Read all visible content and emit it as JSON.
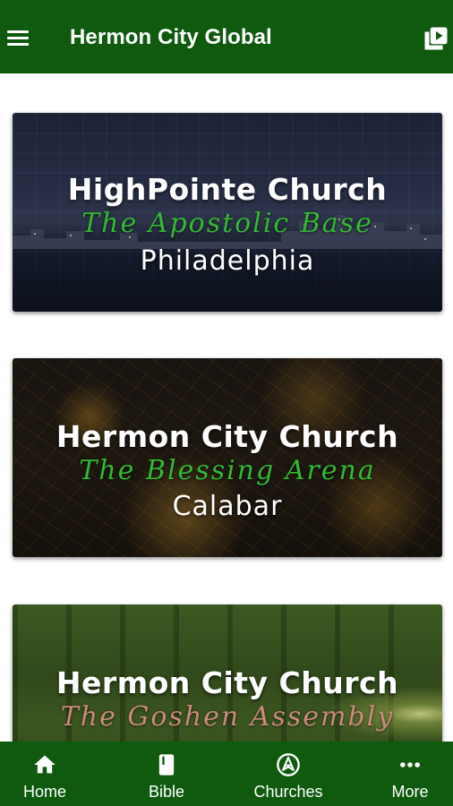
{
  "app_bar": {
    "title": "Hermon City Global",
    "menu_icon": "hamburger-menu-icon",
    "action_icon": "video-library-icon"
  },
  "colors": {
    "primary": "#0f5a0f",
    "accent_green": "#33b833",
    "accent_pink": "#c98a7a",
    "white": "#ffffff"
  },
  "cards": [
    {
      "title": "HighPointe Church",
      "subtitle": "The Apostolic Base",
      "location": "Philadelphia"
    },
    {
      "title": "Hermon City Church",
      "subtitle": "The Blessing Arena",
      "location": "Calabar"
    },
    {
      "title": "Hermon City Church",
      "subtitle": "The Goshen Assembly",
      "location": ""
    }
  ],
  "bottom_nav": [
    {
      "label": "Home",
      "icon": "home-icon"
    },
    {
      "label": "Bible",
      "icon": "book-icon"
    },
    {
      "label": "Churches",
      "icon": "compass-icon"
    },
    {
      "label": "More",
      "icon": "more-dots-icon"
    }
  ]
}
